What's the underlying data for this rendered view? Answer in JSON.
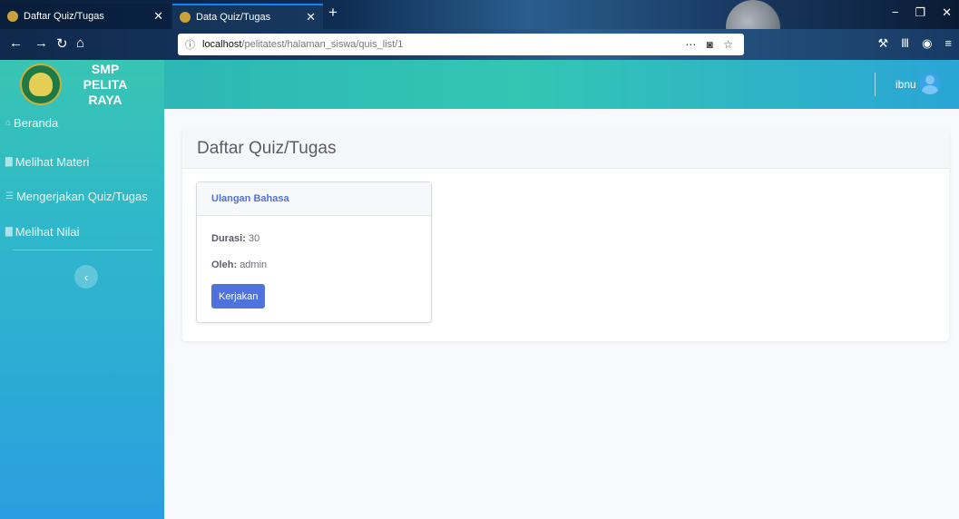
{
  "browser": {
    "tabs": [
      {
        "title": "Daftar Quiz/Tugas",
        "close": "✕"
      },
      {
        "title": "Data Quiz/Tugas",
        "close": "✕"
      }
    ],
    "new_tab": "+",
    "url": {
      "host": "localhost",
      "path": "/pelitatest/halaman_siswa/quis_list/1"
    },
    "url_actions": "⋯ ◙ ☆",
    "window_controls": [
      "−",
      "❐",
      "✕"
    ]
  },
  "sidebar": {
    "brand": {
      "line1": "SMP PELITA",
      "line2": "RAYA"
    },
    "items": [
      {
        "label": "Beranda",
        "icon": "home-icon"
      },
      {
        "label": "Melihat Materi",
        "icon": "book-icon"
      },
      {
        "label": "Mengerjakan Quiz/Tugas",
        "icon": "list-icon"
      },
      {
        "label": "Melihat Nilai",
        "icon": "chart-icon"
      }
    ],
    "toggle": "‹"
  },
  "topbar": {
    "username": "ibnu"
  },
  "main": {
    "page_title": "Daftar Quiz/Tugas",
    "quiz": {
      "title": "Ulangan Bahasa",
      "durasi_label": "Durasi:",
      "durasi_value": "30",
      "oleh_label": "Oleh:",
      "oleh_value": "admin",
      "button": "Kerjakan"
    }
  },
  "colors": {
    "primary": "#4e73df",
    "sidebar_top": "#39c5b3",
    "sidebar_bottom": "#2a9ee0"
  }
}
